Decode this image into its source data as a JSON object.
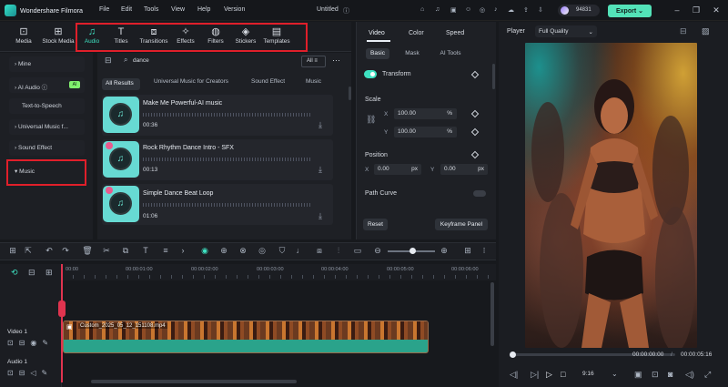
{
  "app": {
    "name": "Wondershare Filmora",
    "title": "Untitled"
  },
  "menu": [
    "File",
    "Edit",
    "Tools",
    "View",
    "Help",
    "Version"
  ],
  "credits": "94831",
  "export_label": "Export",
  "toolbar": [
    {
      "label": "Media",
      "icon": "media-icon"
    },
    {
      "label": "Stock Media",
      "icon": "stock-media-icon"
    },
    {
      "label": "Audio",
      "icon": "audio-note-icon"
    },
    {
      "label": "Titles",
      "icon": "titles-icon"
    },
    {
      "label": "Transitions",
      "icon": "transitions-icon"
    },
    {
      "label": "Effects",
      "icon": "effects-icon"
    },
    {
      "label": "Filters",
      "icon": "filters-icon"
    },
    {
      "label": "Stickers",
      "icon": "stickers-icon"
    },
    {
      "label": "Templates",
      "icon": "templates-icon"
    }
  ],
  "left_nav": [
    "Mine",
    "AI Audio",
    "Text-to-Speech",
    "Universal Music f...",
    "Sound Effect",
    "Music"
  ],
  "ai_chip": "AI",
  "search": {
    "value": "dance",
    "filter": "All"
  },
  "result_tabs": [
    "All Results",
    "Universal Music for Creators",
    "Sound Effect",
    "Music"
  ],
  "tracks": [
    {
      "name": "Make Me Powerful-AI music",
      "duration": "00:36"
    },
    {
      "name": "Rock Rhythm Dance Intro - SFX",
      "duration": "00:13"
    },
    {
      "name": "Simple Dance Beat Loop",
      "duration": "01:06"
    }
  ],
  "props": {
    "tabs": [
      "Video",
      "Color",
      "Speed"
    ],
    "subtabs": [
      "Basic",
      "Mask",
      "AI Tools"
    ],
    "transform": "Transform",
    "scale": "Scale",
    "x_label": "X",
    "y_label": "Y",
    "scale_x": "100.00",
    "scale_y": "100.00",
    "percent": "%",
    "position": "Position",
    "pos_x": "0.00",
    "pos_y": "0.00",
    "px": "px",
    "path_curve": "Path Curve",
    "reset": "Reset",
    "keyframe": "Keyframe Panel"
  },
  "player": {
    "label": "Player",
    "quality": "Full Quality",
    "time_current": "00:00:00:00",
    "time_total": "00:00:05:16",
    "ratio": "9:16",
    "progress_fraction": 0
  },
  "timeline": {
    "ticks": [
      "00:00",
      "00:00:01:00",
      "00:00:02:00",
      "00:00:03:00",
      "00:00:04:00",
      "00:00:05:00",
      "00:00:06:00"
    ],
    "video_track": "Video 1",
    "audio_track": "Audio 1",
    "clip_name": "Custom_2025_05_12_151108.mp4"
  },
  "colors": {
    "accent": "#3ee1c1",
    "highlight_box": "#e01f2a",
    "playhead": "#e0344f",
    "export": "#53e2b8"
  }
}
